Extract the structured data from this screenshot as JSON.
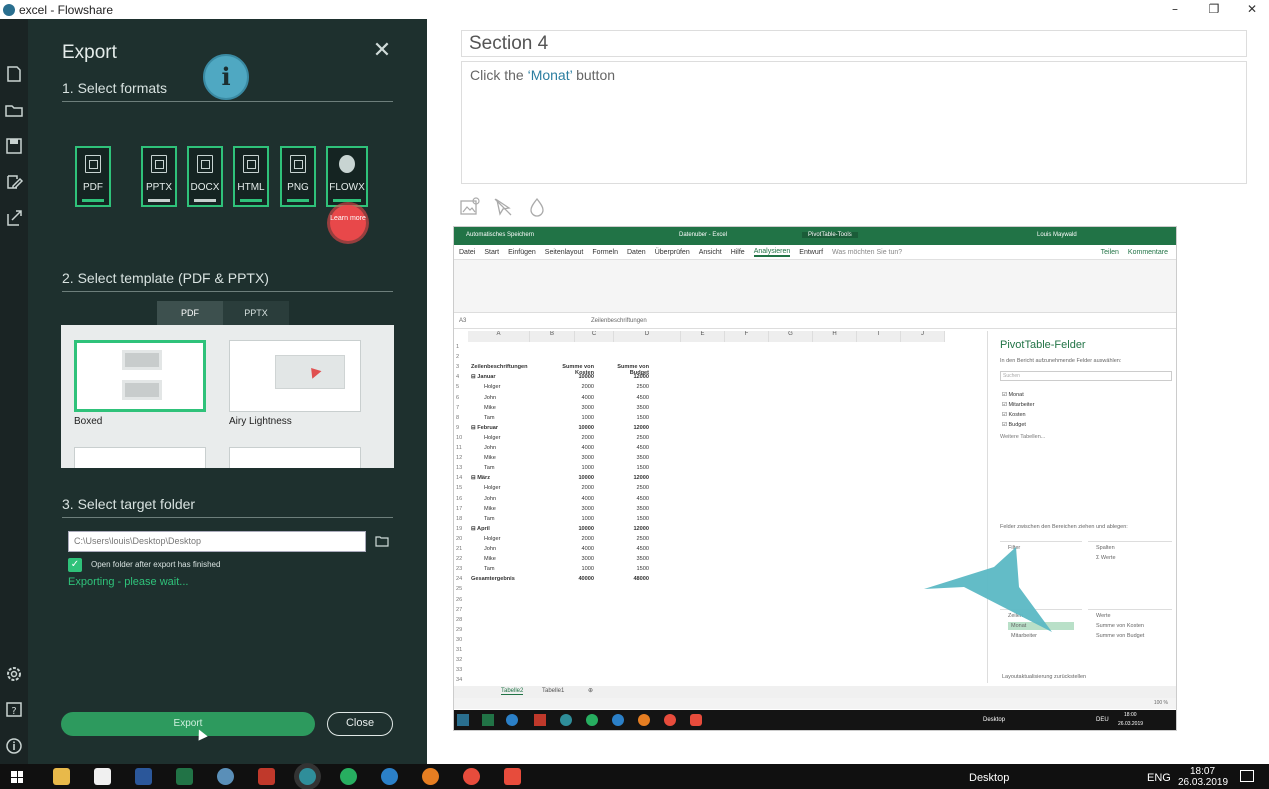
{
  "window": {
    "title": "excel - Flowshare",
    "minimize": "–",
    "maximize": "❐",
    "close": "✕"
  },
  "export_panel": {
    "title": "Export",
    "close_symbol": "✕",
    "info_symbol": "i",
    "section1": "1. Select formats",
    "formats": [
      {
        "label": "PDF",
        "icon": "pdf-icon",
        "bar": "green"
      },
      {
        "label": "PPTX",
        "icon": "pptx-icon",
        "bar": "gray"
      },
      {
        "label": "DOCX",
        "icon": "docx-icon",
        "bar": "gray"
      },
      {
        "label": "HTML",
        "icon": "html-icon",
        "bar": "green"
      },
      {
        "label": "PNG",
        "icon": "png-icon",
        "bar": "green"
      },
      {
        "label": "FLOWX",
        "icon": "flowx-icon",
        "bar": "green"
      }
    ],
    "learn_more": "Learn more",
    "section2": "2. Select template (PDF & PPTX)",
    "template_tabs": [
      "PDF",
      "PPTX"
    ],
    "templates": [
      {
        "name": "Boxed",
        "selected": true
      },
      {
        "name": "Airy Lightness",
        "selected": false
      }
    ],
    "section3": "3. Select target folder",
    "folder_path": "C:\\Users\\louis\\Desktop\\Desktop",
    "open_folder_label": "Open folder after export has finished",
    "status": "Exporting - please wait...",
    "export_button": "Export",
    "close_button": "Close"
  },
  "editor": {
    "section_title": "Section 4",
    "instruction_prefix": "Click the ",
    "instruction_target": "‘Monat’",
    "instruction_suffix": " button"
  },
  "excel": {
    "title_left": "Automatisches Speichern",
    "title_center": "Datenuber - Excel",
    "title_pivot": "PivotTable-Tools",
    "user": "Louis Maywald",
    "menu": [
      "Datei",
      "Start",
      "Einfügen",
      "Seitenlayout",
      "Formeln",
      "Daten",
      "Überprüfen",
      "Ansicht",
      "Hilfe",
      "Analysieren",
      "Entwurf",
      "Was möchten Sie tun?",
      "Teilen",
      "Kommentare"
    ],
    "cell_ref": "A3",
    "formula": "Zeilenbeschriftungen",
    "columns": [
      "A",
      "B",
      "C",
      "D",
      "E",
      "F",
      "G",
      "H",
      "I",
      "J"
    ],
    "header": [
      "Zeilenbeschriftungen",
      "Summe von Kosten",
      "Summe von Budget"
    ],
    "rows": [
      {
        "n": "1",
        "a": "",
        "b": "",
        "c": ""
      },
      {
        "n": "2",
        "a": "",
        "b": "",
        "c": ""
      },
      {
        "n": "3",
        "a": "Zeilenbeschriftungen",
        "b": "Summe von Kosten",
        "c": "Summe von Budget",
        "bold": true
      },
      {
        "n": "4",
        "a": "⊟ Januar",
        "b": "10000",
        "c": "12000",
        "bold": true
      },
      {
        "n": "5",
        "a": "Holger",
        "b": "2000",
        "c": "2500"
      },
      {
        "n": "6",
        "a": "John",
        "b": "4000",
        "c": "4500"
      },
      {
        "n": "7",
        "a": "Mike",
        "b": "3000",
        "c": "3500"
      },
      {
        "n": "8",
        "a": "Tam",
        "b": "1000",
        "c": "1500"
      },
      {
        "n": "9",
        "a": "⊟ Februar",
        "b": "10000",
        "c": "12000",
        "bold": true
      },
      {
        "n": "10",
        "a": "Holger",
        "b": "2000",
        "c": "2500"
      },
      {
        "n": "11",
        "a": "John",
        "b": "4000",
        "c": "4500"
      },
      {
        "n": "12",
        "a": "Mike",
        "b": "3000",
        "c": "3500"
      },
      {
        "n": "13",
        "a": "Tam",
        "b": "1000",
        "c": "1500"
      },
      {
        "n": "14",
        "a": "⊟ März",
        "b": "10000",
        "c": "12000",
        "bold": true
      },
      {
        "n": "15",
        "a": "Holger",
        "b": "2000",
        "c": "2500"
      },
      {
        "n": "16",
        "a": "John",
        "b": "4000",
        "c": "4500"
      },
      {
        "n": "17",
        "a": "Mike",
        "b": "3000",
        "c": "3500"
      },
      {
        "n": "18",
        "a": "Tam",
        "b": "1000",
        "c": "1500"
      },
      {
        "n": "19",
        "a": "⊟ April",
        "b": "10000",
        "c": "12000",
        "bold": true
      },
      {
        "n": "20",
        "a": "Holger",
        "b": "2000",
        "c": "2500"
      },
      {
        "n": "21",
        "a": "John",
        "b": "4000",
        "c": "4500"
      },
      {
        "n": "22",
        "a": "Mike",
        "b": "3000",
        "c": "3500"
      },
      {
        "n": "23",
        "a": "Tam",
        "b": "1000",
        "c": "1500"
      },
      {
        "n": "24",
        "a": "Gesamtergebnis",
        "b": "40000",
        "c": "48000",
        "bold": true
      },
      {
        "n": "25",
        "a": "",
        "b": "",
        "c": ""
      },
      {
        "n": "26",
        "a": "",
        "b": "",
        "c": ""
      },
      {
        "n": "27",
        "a": "",
        "b": "",
        "c": ""
      },
      {
        "n": "28",
        "a": "",
        "b": "",
        "c": ""
      },
      {
        "n": "29",
        "a": "",
        "b": "",
        "c": ""
      },
      {
        "n": "30",
        "a": "",
        "b": "",
        "c": ""
      },
      {
        "n": "31",
        "a": "",
        "b": "",
        "c": ""
      },
      {
        "n": "32",
        "a": "",
        "b": "",
        "c": ""
      },
      {
        "n": "33",
        "a": "",
        "b": "",
        "c": ""
      },
      {
        "n": "34",
        "a": "",
        "b": "",
        "c": ""
      }
    ],
    "pivot_title": "PivotTable-Felder",
    "pivot_sub": "In den Bericht aufzunehmende Felder auswählen:",
    "pivot_search": "Suchen",
    "pivot_fields": [
      "Monat",
      "Mitarbeiter",
      "Kosten",
      "Budget"
    ],
    "more_tables": "Weitere Tabellen...",
    "drag_hint": "Felder zwischen den Bereichen ziehen und ablegen:",
    "area_filter": "Filter",
    "area_columns": "Spalten",
    "area_columns_value": "Σ Werte",
    "area_rows": "Zeilen",
    "area_rows_items": [
      "Monat",
      "Mitarbeiter"
    ],
    "area_values": "Werte",
    "area_values_items": [
      "Summe von Kosten",
      "Summe von Budget"
    ],
    "defer": "Layoutaktualisierung zurückstellen",
    "update": "Aktualisieren",
    "sheets": [
      "Tabelle2",
      "Tabelle1"
    ],
    "zoom": "100 %",
    "inner_time": "18:00",
    "inner_date": "26.03.2019",
    "inner_lang": "DEU",
    "inner_desktop": "Desktop"
  },
  "taskbar": {
    "desktop": "Desktop",
    "lang": "ENG",
    "time": "18:07",
    "date": "26.03.2019"
  },
  "colors": {
    "accent_green": "#2fc27a",
    "panel_bg": "#1e302e",
    "excel_green": "#217346",
    "highlight_teal": "#5bb8c4"
  }
}
